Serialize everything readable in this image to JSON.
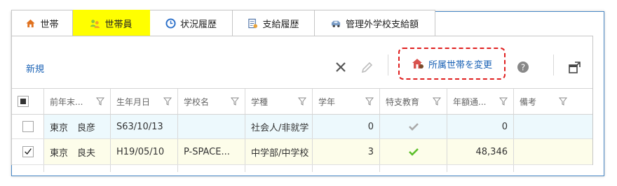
{
  "tabs": [
    {
      "label": "世帯",
      "icon": "house-icon"
    },
    {
      "label": "世帯員",
      "icon": "people-icon"
    },
    {
      "label": "状況履歴",
      "icon": "clock-icon"
    },
    {
      "label": "支給履歴",
      "icon": "ledger-icon"
    },
    {
      "label": "管理外学校支給額",
      "icon": "vehicle-icon"
    }
  ],
  "toolbar": {
    "new_label": "新規",
    "change_household_label": "所属世帯を変更"
  },
  "columns": [
    "前年末...",
    "生年月日",
    "学校名",
    "学種",
    "学年",
    "特支教育",
    "年額通...",
    "備考"
  ],
  "rows": [
    {
      "selected": false,
      "name": "東京　良彦",
      "birth": "S63/10/13",
      "school": "",
      "type": "社会人/非就学",
      "grade": "0",
      "special": "gray",
      "amount": "0",
      "note": ""
    },
    {
      "selected": true,
      "name": "東京　良夫",
      "birth": "H19/05/10",
      "school": "P-SPACE...",
      "type": "中学部/中学校",
      "grade": "3",
      "special": "green",
      "amount": "48,346",
      "note": ""
    }
  ],
  "colors": {
    "accent": "#1a62b5",
    "active_tab": "#ffff00",
    "highlight_border": "#e02020",
    "row1_bg": "#edf9fd",
    "row2_bg": "#fdfdea"
  }
}
